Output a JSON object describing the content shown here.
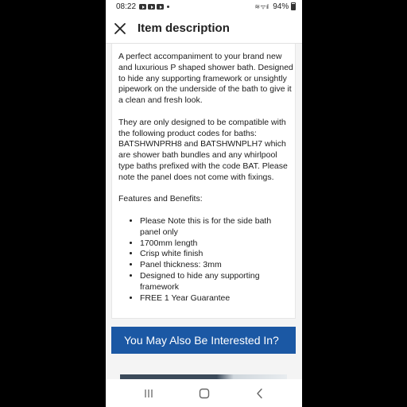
{
  "status_bar": {
    "time": "08:22",
    "app_icons": [
      "youtube-icon",
      "youtube-icon",
      "youtube-icon"
    ],
    "signal_icons": "≋ ᯤ ıl",
    "battery": "94%"
  },
  "header": {
    "title": "Item description",
    "close_icon": "close-icon"
  },
  "description": {
    "paragraphs": [
      "A perfect accompaniment to your brand new and luxurious P shaped shower bath. Designed to hide any supporting framework or unsightly pipework on the underside of the bath to give it a clean and fresh look.",
      "They are only designed to be compatible with the following product codes for baths: BATSHWNPRH8 and BATSHWNPLH7 which are shower bath bundles and any whirlpool type baths prefixed with the code BAT. Please note the panel does not come with fixings.",
      "Features and Benefits:"
    ],
    "features": [
      "Please Note this is for the side bath panel only",
      "1700mm length",
      "Crisp white finish",
      "Panel thickness: 3mm",
      "Designed to hide any supporting framework",
      "FREE 1 Year Guarantee"
    ]
  },
  "interest_banner": "You May Also Be Interested In?",
  "nav_bar": [
    "recent-apps-icon",
    "home-icon",
    "back-icon"
  ],
  "colors": {
    "banner": "#1b58a4",
    "background": "#f4f4f4"
  }
}
